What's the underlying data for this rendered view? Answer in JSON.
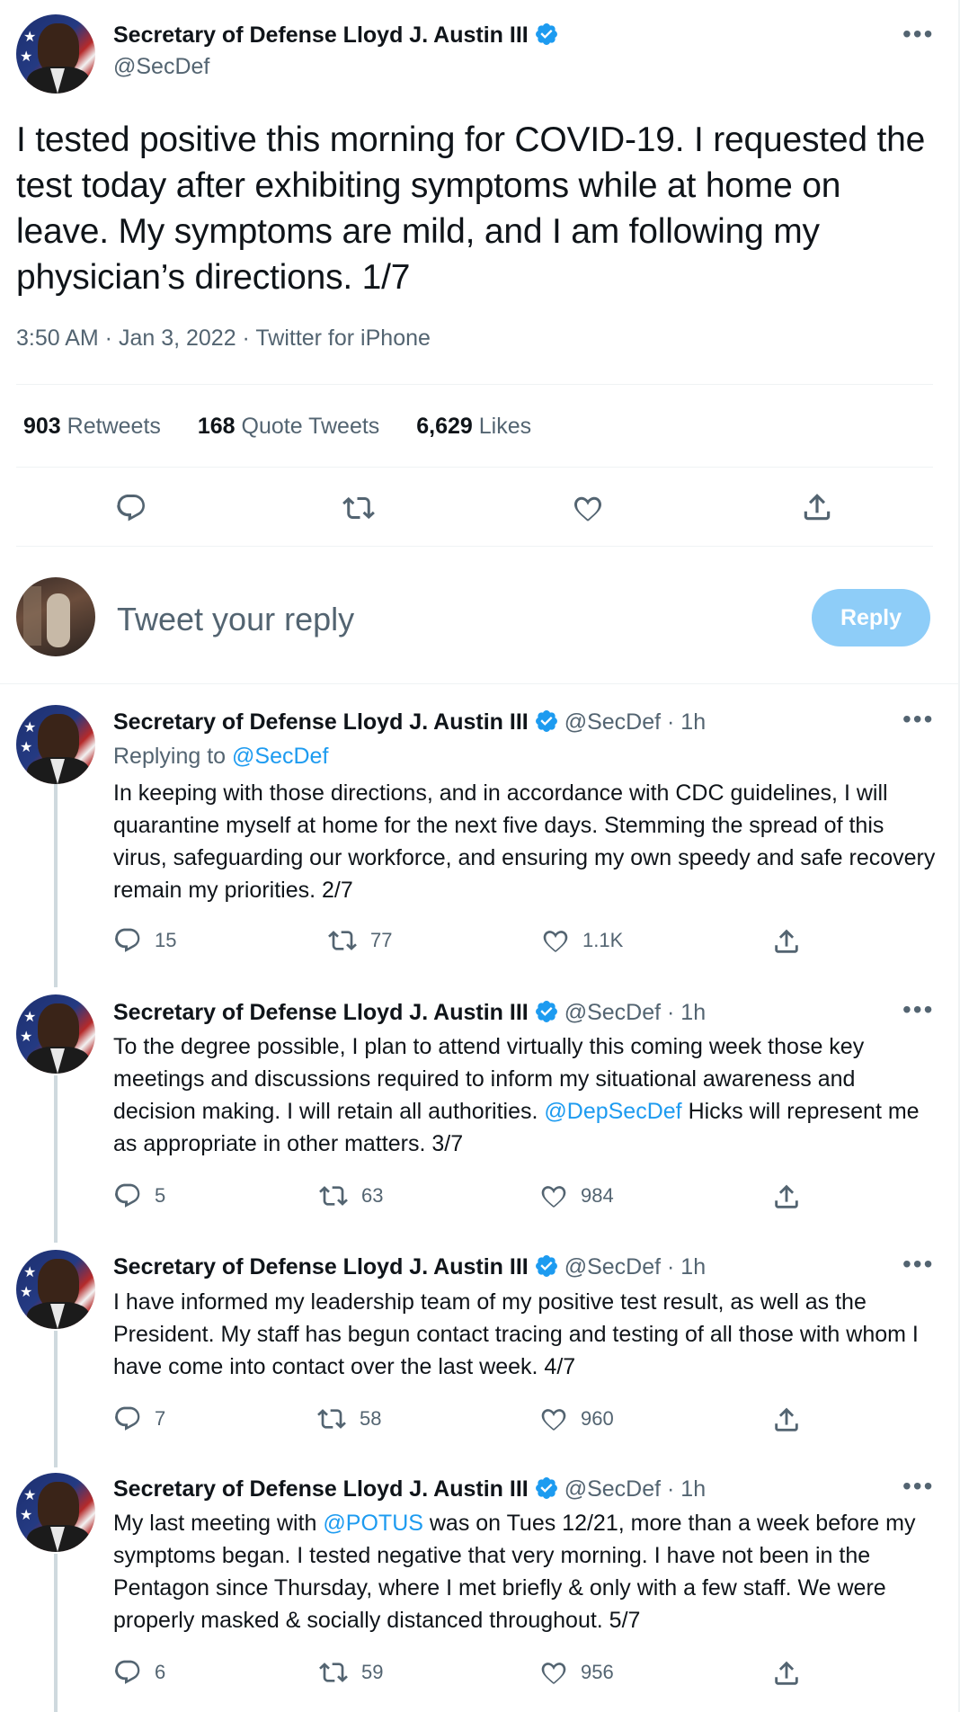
{
  "author": {
    "name": "Secretary of Defense Lloyd J. Austin III",
    "handle": "@SecDef"
  },
  "main_tweet": {
    "text": "I tested positive this morning for COVID-19. I requested the test today after exhibiting symptoms while at home on leave. My symptoms are mild, and I am following my physician’s directions. 1/7",
    "meta": "3:50 AM · Jan 3, 2022 · Twitter for iPhone",
    "retweets_count": "903",
    "retweets_label": "Retweets",
    "quotes_count": "168",
    "quotes_label": "Quote Tweets",
    "likes_count": "6,629",
    "likes_label": "Likes"
  },
  "reply_box": {
    "placeholder": "Tweet your reply",
    "button_label": "Reply"
  },
  "thread": [
    {
      "handle_time": "@SecDef · 1h",
      "replying_prefix": "Replying to",
      "replying_handle": "@SecDef",
      "text": "In keeping with those directions, and in accordance with CDC guidelines, I will quarantine myself at home for the next five days. Stemming the spread of this virus, safeguarding our workforce, and ensuring my own speedy and safe recovery remain my priorities. 2/7",
      "replies": "15",
      "retweets": "77",
      "likes": "1.1K"
    },
    {
      "handle_time": "@SecDef · 1h",
      "text_before": "To the degree possible, I plan to attend virtually this coming week those key meetings and discussions required to inform my situational awareness and decision making. I will retain all authorities. ",
      "mention": "@DepSecDef",
      "text_after": " Hicks will represent me as appropriate in other matters. 3/7",
      "replies": "5",
      "retweets": "63",
      "likes": "984"
    },
    {
      "handle_time": "@SecDef · 1h",
      "text": "I have informed my leadership team of my positive test result, as well as the President. My staff has begun contact tracing and testing of all those with whom I have come into contact over the last week. 4/7",
      "replies": "7",
      "retweets": "58",
      "likes": "960"
    },
    {
      "handle_time": "@SecDef · 1h",
      "text_before": "My last meeting with ",
      "mention": "@POTUS",
      "text_after": " was on Tues 12/21, more than a week before my symptoms began. I tested negative that very morning. I have not been in the Pentagon since Thursday, where I met briefly & only with a few staff. We were properly masked & socially distanced throughout. 5/7",
      "replies": "6",
      "retweets": "59",
      "likes": "956"
    }
  ],
  "icons": {
    "reply": "reply-bubble-icon",
    "retweet": "retweet-arrows-icon",
    "like": "heart-icon",
    "share": "share-upload-icon",
    "verified": "verified-badge-icon",
    "more": "more-dots-icon"
  },
  "colors": {
    "link": "#1d9bf0",
    "secondary_text": "#536471",
    "reply_button_disabled": "#8ecdf8",
    "divider": "#eff3f4"
  }
}
